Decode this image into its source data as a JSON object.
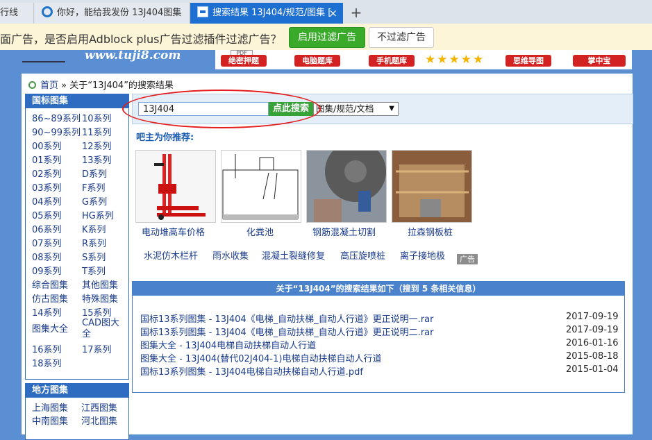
{
  "browser": {
    "tabs": [
      {
        "label": "行线"
      },
      {
        "label": "你好，能给我发份 13J404图集"
      },
      {
        "label": "搜索结果 13J404/规范/图集 [",
        "close": "×"
      }
    ],
    "new_tab": "+"
  },
  "adblock": {
    "message": "面广告，是否启用Adblock plus广告过滤插件过滤广告？",
    "enable_label": "启用过滤广告",
    "skip_label": "不过滤广告"
  },
  "site": {
    "url": "www.tuji8.com",
    "banner": {
      "items": [
        "绝密押题",
        "电脑题库",
        "手机题库",
        "思维导图",
        "掌中宝"
      ],
      "pdf_tag": "PDF",
      "stars": "★★★★★"
    }
  },
  "breadcrumb": {
    "home": "首页",
    "separator": "»",
    "current": "关于“13J404”的搜索结果"
  },
  "sidebar": {
    "national": {
      "title": "国标图集",
      "items": [
        "86~89系列",
        "10系列",
        "90~99系列",
        "11系列",
        "00系列",
        "12系列",
        "01系列",
        "13系列",
        "02系列",
        "D系列",
        "03系列",
        "F系列",
        "04系列",
        "G系列",
        "05系列",
        "HG系列",
        "06系列",
        "K系列",
        "07系列",
        "R系列",
        "08系列",
        "S系列",
        "09系列",
        "T系列",
        "综合图集",
        "其他图集",
        "仿古图集",
        "特殊图集",
        "14系列",
        "15系列",
        "图集大全",
        "CAD图大全",
        "16系列",
        "17系列",
        "18系列"
      ]
    },
    "local": {
      "title": "地方图集",
      "items": [
        "上海图集",
        "江西图集",
        "中南图集",
        "河北图集"
      ]
    }
  },
  "search": {
    "value": "13J404",
    "button": "点此搜索",
    "select_value": "图集/规范/文档"
  },
  "recommend": {
    "title": "吧主为你推荐:",
    "cards": [
      "电动堆高车价格",
      "化粪池",
      "钢筋混凝土切割",
      "拉森钢板桩"
    ],
    "links": [
      "水泥仿木栏杆",
      "雨水收集",
      "混凝土裂缝修复",
      "高压旋喷桩",
      "离子接地极"
    ],
    "ad_tag": "广告"
  },
  "results": {
    "header": "关于“13J404”的搜索结果如下（搜到 5 条相关信息）",
    "rows": [
      {
        "title": "国标13系列图集 - 13J404《电梯_自动扶梯_自动人行道》更正说明一.rar",
        "date": "2017-09-19"
      },
      {
        "title": "国标13系列图集 - 13J404《电梯_自动扶梯_自动人行道》更正说明二.rar",
        "date": "2017-09-19"
      },
      {
        "title": "图集大全 - 13J404电梯自动扶梯自动人行道",
        "date": "2016-01-16"
      },
      {
        "title": "图集大全 - 13J404(替代02J404-1)电梯自动扶梯自动人行道",
        "date": "2015-08-18"
      },
      {
        "title": "国标13系列图集 - 13J404电梯自动扶梯自动人行道.pdf",
        "date": "2015-01-04"
      }
    ]
  }
}
